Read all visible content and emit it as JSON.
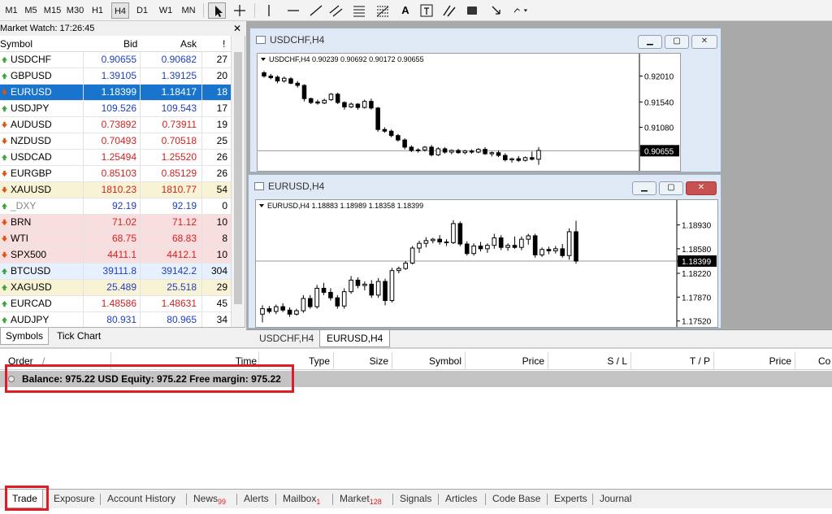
{
  "toolbar": {
    "timeframes": [
      "M1",
      "M5",
      "M15",
      "M30",
      "H1",
      "H4",
      "D1",
      "W1",
      "MN"
    ],
    "active_timeframe": "H4",
    "text_tool": "A"
  },
  "market_watch": {
    "title": "Market Watch: 17:26:45",
    "columns": [
      "Symbol",
      "Bid",
      "Ask",
      "!"
    ],
    "rows": [
      {
        "symbol": "USDCHF",
        "bid": "0.90655",
        "ask": "0.90682",
        "spread": "27",
        "dir": "up",
        "bg": "#ffffff",
        "color": "#1f3fbf"
      },
      {
        "symbol": "GBPUSD",
        "bid": "1.39105",
        "ask": "1.39125",
        "spread": "20",
        "dir": "up",
        "bg": "#ffffff",
        "color": "#1f3fbf"
      },
      {
        "symbol": "EURUSD",
        "bid": "1.18399",
        "ask": "1.18417",
        "spread": "18",
        "dir": "down",
        "bg": "#1874cd",
        "color": "#ffffff"
      },
      {
        "symbol": "USDJPY",
        "bid": "109.526",
        "ask": "109.543",
        "spread": "17",
        "dir": "up",
        "bg": "#ffffff",
        "color": "#1f3fbf"
      },
      {
        "symbol": "AUDUSD",
        "bid": "0.73892",
        "ask": "0.73911",
        "spread": "19",
        "dir": "down",
        "bg": "#ffffff",
        "color": "#d42020"
      },
      {
        "symbol": "NZDUSD",
        "bid": "0.70493",
        "ask": "0.70518",
        "spread": "25",
        "dir": "down",
        "bg": "#ffffff",
        "color": "#d42020"
      },
      {
        "symbol": "USDCAD",
        "bid": "1.25494",
        "ask": "1.25520",
        "spread": "26",
        "dir": "up",
        "bg": "#ffffff",
        "color": "#d42020"
      },
      {
        "symbol": "EURGBP",
        "bid": "0.85103",
        "ask": "0.85129",
        "spread": "26",
        "dir": "down",
        "bg": "#ffffff",
        "color": "#d42020"
      },
      {
        "symbol": "XAUUSD",
        "bid": "1810.23",
        "ask": "1810.77",
        "spread": "54",
        "dir": "down",
        "bg": "#f8f3d4",
        "color": "#d42020"
      },
      {
        "symbol": "_DXY",
        "bid": "92.19",
        "ask": "92.19",
        "spread": "0",
        "dir": "up",
        "bg": "#ffffff",
        "color": "#1f3fbf",
        "sym_color": "#888888"
      },
      {
        "symbol": "BRN",
        "bid": "71.02",
        "ask": "71.12",
        "spread": "10",
        "dir": "down",
        "bg": "#f8dede",
        "color": "#d42020"
      },
      {
        "symbol": "WTI",
        "bid": "68.75",
        "ask": "68.83",
        "spread": "8",
        "dir": "down",
        "bg": "#f8dede",
        "color": "#d42020"
      },
      {
        "symbol": "SPX500",
        "bid": "4411.1",
        "ask": "4412.1",
        "spread": "10",
        "dir": "down",
        "bg": "#f8dede",
        "color": "#d42020"
      },
      {
        "symbol": "BTCUSD",
        "bid": "39111.8",
        "ask": "39142.2",
        "spread": "304",
        "dir": "up",
        "bg": "#e6f0ff",
        "color": "#1f3fbf"
      },
      {
        "symbol": "XAGUSD",
        "bid": "25.489",
        "ask": "25.518",
        "spread": "29",
        "dir": "up",
        "bg": "#f8f3d4",
        "color": "#1f3fbf"
      },
      {
        "symbol": "EURCAD",
        "bid": "1.48586",
        "ask": "1.48631",
        "spread": "45",
        "dir": "up",
        "bg": "#ffffff",
        "color": "#d42020"
      },
      {
        "symbol": "AUDJPY",
        "bid": "80.931",
        "ask": "80.965",
        "spread": "34",
        "dir": "up",
        "bg": "#ffffff",
        "color": "#1f3fbf"
      }
    ],
    "tabs": [
      "Symbols",
      "Tick Chart"
    ],
    "active_tab": "Symbols"
  },
  "charts": [
    {
      "window_title": "USDCHF,H4",
      "info": "USDCHF,H4  0.90239 0.90692 0.90172 0.90655",
      "price_labels": [
        "0.92010",
        "0.91540",
        "0.91080",
        "0.90655"
      ],
      "current_price": "0.90655",
      "ylim": [
        0.9035,
        0.9215
      ],
      "candles": [
        [
          0.9207,
          0.921,
          0.9198,
          0.9201
        ],
        [
          0.9201,
          0.9205,
          0.9195,
          0.9198
        ],
        [
          0.9199,
          0.9202,
          0.9188,
          0.9192
        ],
        [
          0.9192,
          0.92,
          0.9189,
          0.9197
        ],
        [
          0.9196,
          0.9199,
          0.9186,
          0.9188
        ],
        [
          0.9188,
          0.9192,
          0.918,
          0.9184
        ],
        [
          0.9184,
          0.9186,
          0.9155,
          0.916
        ],
        [
          0.916,
          0.9162,
          0.915,
          0.9153
        ],
        [
          0.9154,
          0.9158,
          0.9149,
          0.9152
        ],
        [
          0.9152,
          0.916,
          0.915,
          0.9157
        ],
        [
          0.9158,
          0.917,
          0.9156,
          0.9168
        ],
        [
          0.9168,
          0.9171,
          0.915,
          0.9153
        ],
        [
          0.9153,
          0.9155,
          0.914,
          0.9145
        ],
        [
          0.9145,
          0.9153,
          0.9143,
          0.915
        ],
        [
          0.915,
          0.9152,
          0.914,
          0.9144
        ],
        [
          0.9144,
          0.9158,
          0.9142,
          0.9155
        ],
        [
          0.9155,
          0.916,
          0.914,
          0.9143
        ],
        [
          0.9143,
          0.9145,
          0.91,
          0.9104
        ],
        [
          0.9104,
          0.9108,
          0.9098,
          0.9101
        ],
        [
          0.9101,
          0.9104,
          0.909,
          0.9093
        ],
        [
          0.9093,
          0.9096,
          0.9082,
          0.9085
        ],
        [
          0.9085,
          0.9088,
          0.9068,
          0.9072
        ],
        [
          0.9072,
          0.9075,
          0.9063,
          0.9066
        ],
        [
          0.9066,
          0.907,
          0.9062,
          0.9067
        ],
        [
          0.9067,
          0.9074,
          0.9064,
          0.9072
        ],
        [
          0.9072,
          0.9076,
          0.9055,
          0.9058
        ],
        [
          0.9058,
          0.9072,
          0.9056,
          0.9069
        ],
        [
          0.9069,
          0.9072,
          0.906,
          0.9063
        ],
        [
          0.9063,
          0.9068,
          0.9059,
          0.9066
        ],
        [
          0.9066,
          0.9069,
          0.906,
          0.9062
        ],
        [
          0.9062,
          0.9067,
          0.9059,
          0.9065
        ],
        [
          0.9065,
          0.9068,
          0.906,
          0.9063
        ],
        [
          0.9063,
          0.907,
          0.9061,
          0.9068
        ],
        [
          0.9068,
          0.9072,
          0.9058,
          0.906
        ],
        [
          0.906,
          0.9064,
          0.9055,
          0.9062
        ],
        [
          0.9062,
          0.9066,
          0.9054,
          0.9057
        ],
        [
          0.9057,
          0.9061,
          0.9046,
          0.9049
        ],
        [
          0.9049,
          0.9053,
          0.9044,
          0.9051
        ],
        [
          0.9051,
          0.9056,
          0.9045,
          0.9048
        ],
        [
          0.9048,
          0.9055,
          0.9046,
          0.9053
        ],
        [
          0.9053,
          0.9064,
          0.9048,
          0.905
        ],
        [
          0.905,
          0.9072,
          0.904,
          0.9066
        ]
      ]
    },
    {
      "window_title": "EURUSD,H4",
      "info": "EURUSD,H4  1.18883 1.18989 1.18358 1.18399",
      "price_labels": [
        "1.18930",
        "1.18580",
        "1.18220",
        "1.17870",
        "1.17520",
        "1.18399"
      ],
      "current_price": "1.18399",
      "ylim": [
        1.1748,
        1.1908
      ],
      "candles": [
        [
          1.1762,
          1.1775,
          1.175,
          1.177
        ],
        [
          1.177,
          1.1774,
          1.1763,
          1.1766
        ],
        [
          1.1766,
          1.1776,
          1.1762,
          1.1773
        ],
        [
          1.1773,
          1.1778,
          1.1765,
          1.1768
        ],
        [
          1.1768,
          1.1772,
          1.1758,
          1.1762
        ],
        [
          1.1762,
          1.177,
          1.176,
          1.1767
        ],
        [
          1.1767,
          1.179,
          1.1764,
          1.1785
        ],
        [
          1.1785,
          1.179,
          1.177,
          1.1773
        ],
        [
          1.1773,
          1.1805,
          1.177,
          1.18
        ],
        [
          1.18,
          1.1808,
          1.179,
          1.1794
        ],
        [
          1.1794,
          1.18,
          1.1782,
          1.1786
        ],
        [
          1.1786,
          1.179,
          1.177,
          1.1774
        ],
        [
          1.1774,
          1.18,
          1.177,
          1.1795
        ],
        [
          1.1795,
          1.1818,
          1.1792,
          1.1812
        ],
        [
          1.1812,
          1.1816,
          1.18,
          1.1804
        ],
        [
          1.1804,
          1.181,
          1.1797,
          1.1806
        ],
        [
          1.1806,
          1.1812,
          1.1786,
          1.179
        ],
        [
          1.179,
          1.1815,
          1.1786,
          1.181
        ],
        [
          1.181,
          1.1814,
          1.1775,
          1.1782
        ],
        [
          1.1782,
          1.183,
          1.1779,
          1.1826
        ],
        [
          1.1826,
          1.1832,
          1.1822,
          1.1829
        ],
        [
          1.1829,
          1.184,
          1.1827,
          1.1837
        ],
        [
          1.1837,
          1.1862,
          1.1835,
          1.1859
        ],
        [
          1.1859,
          1.187,
          1.1852,
          1.1866
        ],
        [
          1.1866,
          1.1875,
          1.186,
          1.187
        ],
        [
          1.187,
          1.1874,
          1.1866,
          1.1872
        ],
        [
          1.1872,
          1.1878,
          1.1864,
          1.1868
        ],
        [
          1.1868,
          1.1872,
          1.1862,
          1.1867
        ],
        [
          1.1867,
          1.19,
          1.1865,
          1.1895
        ],
        [
          1.1895,
          1.1898,
          1.1862,
          1.1865
        ],
        [
          1.1865,
          1.1869,
          1.1848,
          1.1851
        ],
        [
          1.1851,
          1.1866,
          1.1848,
          1.1862
        ],
        [
          1.1862,
          1.1868,
          1.1854,
          1.1858
        ],
        [
          1.1858,
          1.1866,
          1.1852,
          1.1863
        ],
        [
          1.1863,
          1.188,
          1.1858,
          1.1874
        ],
        [
          1.1874,
          1.1878,
          1.1856,
          1.186
        ],
        [
          1.186,
          1.1866,
          1.1855,
          1.1863
        ],
        [
          1.1863,
          1.1876,
          1.1858,
          1.186
        ],
        [
          1.186,
          1.1876,
          1.1856,
          1.1872
        ],
        [
          1.1872,
          1.188,
          1.1864,
          1.1877
        ],
        [
          1.1877,
          1.188,
          1.1845,
          1.1849
        ],
        [
          1.1849,
          1.186,
          1.1846,
          1.1857
        ],
        [
          1.1857,
          1.1861,
          1.185,
          1.1855
        ],
        [
          1.1855,
          1.1862,
          1.1851,
          1.1858
        ],
        [
          1.1858,
          1.1865,
          1.1845,
          1.1848
        ],
        [
          1.1848,
          1.1888,
          1.1842,
          1.1883
        ],
        [
          1.1883,
          1.1899,
          1.1836,
          1.184
        ]
      ]
    }
  ],
  "chart_tabs": [
    "USDCHF,H4",
    "EURUSD,H4"
  ],
  "active_chart_tab": "EURUSD,H4",
  "terminal": {
    "columns": [
      "Order",
      "/",
      "Time",
      "Type",
      "Size",
      "Symbol",
      "Price",
      "S / L",
      "T / P",
      "Price",
      "Co"
    ],
    "balance_text": "Balance: 975.22 USD  Equity: 975.22  Free margin: 975.22",
    "tabs": [
      {
        "label": "Trade",
        "badge": ""
      },
      {
        "label": "Exposure",
        "badge": ""
      },
      {
        "label": "Account History",
        "badge": ""
      },
      {
        "label": "News",
        "badge": "99"
      },
      {
        "label": "Alerts",
        "badge": ""
      },
      {
        "label": "Mailbox",
        "badge": "1"
      },
      {
        "label": "Market",
        "badge": "128"
      },
      {
        "label": "Signals",
        "badge": ""
      },
      {
        "label": "Articles",
        "badge": ""
      },
      {
        "label": "Code Base",
        "badge": ""
      },
      {
        "label": "Experts",
        "badge": ""
      },
      {
        "label": "Journal",
        "badge": ""
      }
    ],
    "active_tab": "Trade"
  },
  "colors": {
    "highlight": "#e01b24",
    "bullish": "#ffffff",
    "bearish": "#000000",
    "selected_row": "#1874cd"
  }
}
